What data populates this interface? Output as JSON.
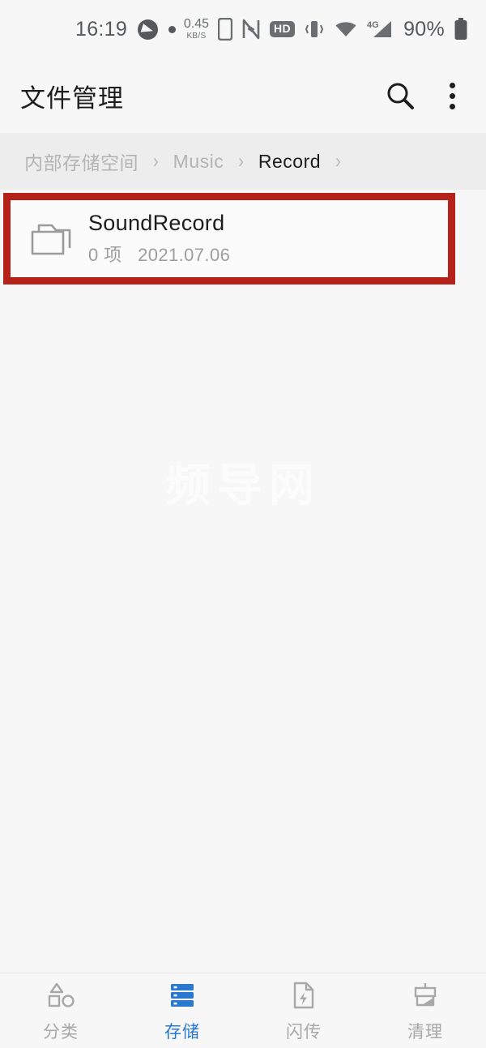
{
  "status_bar": {
    "time": "16:19",
    "notification_icons": [
      "app-notification-icon",
      "dot-indicator"
    ],
    "net_speed_value": "0.45",
    "net_speed_unit": "KB/S",
    "icons": [
      "phone-icon",
      "nfc-icon",
      "hd-badge",
      "vibrate-icon",
      "wifi-icon",
      "signal-4g-icon"
    ],
    "hd_label": "HD",
    "signal_label": "4G",
    "battery_percent": "90%"
  },
  "app_bar": {
    "title": "文件管理",
    "search_icon": "search-icon",
    "menu_icon": "overflow-menu-icon"
  },
  "breadcrumb": {
    "separator": "›",
    "items": [
      {
        "label": "内部存储空间",
        "current": false
      },
      {
        "label": "Music",
        "current": false
      },
      {
        "label": "Record",
        "current": true
      }
    ]
  },
  "file_list": {
    "rows": [
      {
        "icon": "folder-icon",
        "name": "SoundRecord",
        "item_count": "0 项",
        "date": "2021.07.06",
        "highlighted": true
      }
    ]
  },
  "annotation": {
    "highlight_color": "#b4221a"
  },
  "watermark": {
    "text": "频导网"
  },
  "bottom_nav": {
    "active_color": "#2878d0",
    "inactive_color": "#a8a8a8",
    "items": [
      {
        "label": "分类",
        "icon": "shapes-icon",
        "active": false
      },
      {
        "label": "存储",
        "icon": "storage-server-icon",
        "active": true
      },
      {
        "label": "闪传",
        "icon": "flash-transfer-icon",
        "active": false
      },
      {
        "label": "清理",
        "icon": "broom-clean-icon",
        "active": false
      }
    ]
  }
}
